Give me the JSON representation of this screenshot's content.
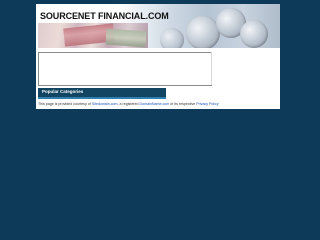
{
  "site": {
    "title": "SOURCENET FINANCIAL.COM"
  },
  "categories": {
    "heading": "Popular Categories"
  },
  "footer": {
    "prefix": "This page is provided courtesy of",
    "link1": "Sitedomain.com",
    "middle": ", a registered ",
    "link2": "DomainName.com",
    "suffix": " of its respective ",
    "privacy_link": "Privacy Policy"
  },
  "colors": {
    "background": "#0d3a58",
    "category_bar": "#114562",
    "link": "#1a4fb8"
  }
}
